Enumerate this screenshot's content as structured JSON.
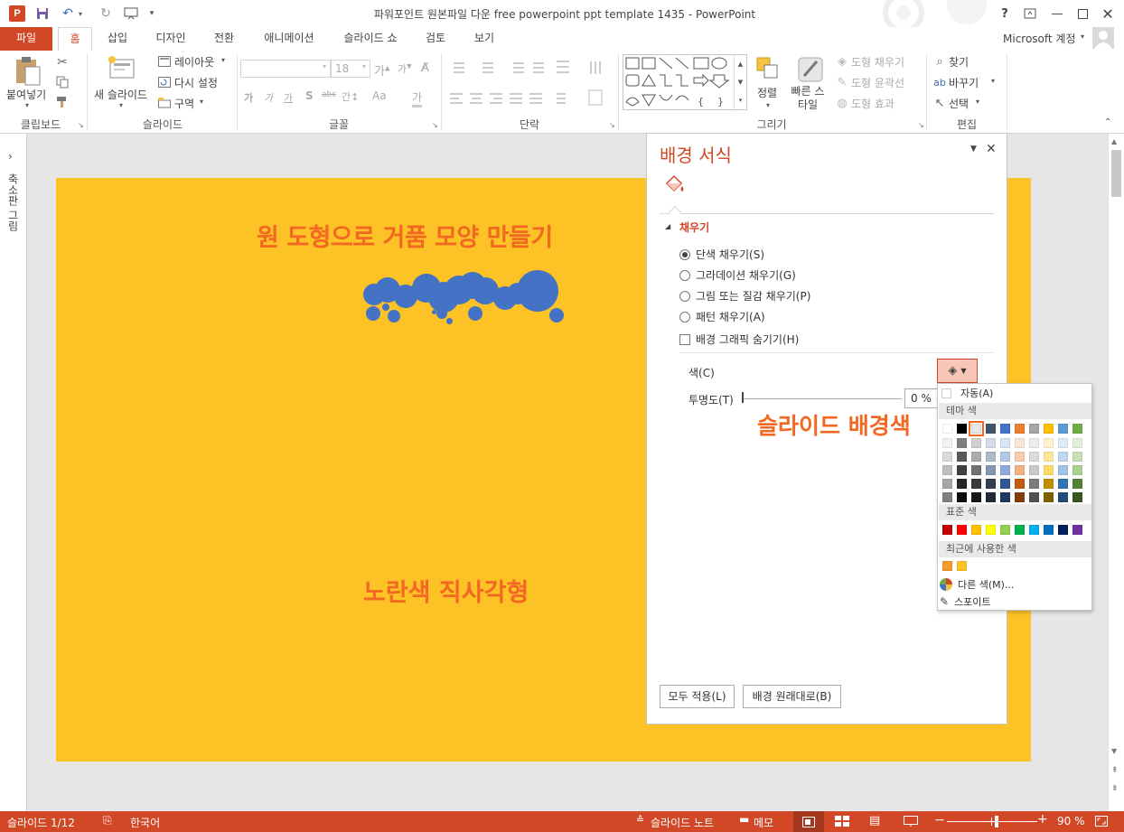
{
  "window": {
    "title": "파워포인트 원본파일 다운 free powerpoint ppt template 1435 - PowerPoint",
    "help": "?",
    "account": "Microsoft 계정"
  },
  "tabs": [
    "파일",
    "홈",
    "삽입",
    "디자인",
    "전환",
    "애니메이션",
    "슬라이드 쇼",
    "검토",
    "보기"
  ],
  "ribbon": {
    "clipboard": {
      "paste": "붙여넣기",
      "group": "클립보드"
    },
    "slides": {
      "new_slide": "새 슬라이드",
      "layout": "레이아웃",
      "reset": "다시 설정",
      "section": "구역",
      "group": "슬라이드"
    },
    "font": {
      "size": "18",
      "group": "글꼴",
      "bold": "가",
      "italic": "가",
      "underline": "가",
      "shadow": "S",
      "strike": "abc",
      "spacing": "간↕",
      "case": "Aa",
      "color": "가"
    },
    "paragraph": {
      "group": "단락"
    },
    "drawing": {
      "arrange": "정렬",
      "quick_styles": "빠른 스타일",
      "fill": "도형 채우기",
      "outline": "도형 윤곽선",
      "effects": "도형 효과",
      "group": "그리기"
    },
    "editing": {
      "find": "찾기",
      "replace": "바꾸기",
      "select": "선택",
      "group": "편집"
    }
  },
  "left_pane": {
    "label": "축소판 그림"
  },
  "slide": {
    "title": "원 도형으로 거품 모양 만들기",
    "bottom_label": "노란색 직사각형",
    "annotation": "슬라이드 배경색",
    "background_color": "#fdc226"
  },
  "format_pane": {
    "title": "배경 서식",
    "section": "채우기",
    "options": [
      "단색 채우기(S)",
      "그라데이션 채우기(G)",
      "그림 또는 질감 채우기(P)",
      "패턴 채우기(A)"
    ],
    "selected_option": 0,
    "hide_graphics": "배경 그래픽 숨기기(H)",
    "color_label": "색(C)",
    "transparency_label": "투명도(T)",
    "transparency_value": "0 %",
    "apply_all": "모두 적용(L)",
    "reset_bg": "배경 원래대로(B)"
  },
  "color_menu": {
    "auto": "자동(A)",
    "theme_header": "테마 색",
    "standard_header": "표준 색",
    "recent_header": "최근에 사용한 색",
    "more_colors": "다른 색(M)...",
    "eyedropper": "스포이트",
    "theme_colors": [
      [
        "#ffffff",
        "#f2f2f2",
        "#d9d9d9",
        "#bfbfbf",
        "#a6a6a6",
        "#808080"
      ],
      [
        "#000000",
        "#7f7f7f",
        "#595959",
        "#404040",
        "#262626",
        "#0d0d0d"
      ],
      [
        "#e7e6e6",
        "#d0cece",
        "#aeabab",
        "#757171",
        "#3a3838",
        "#171616"
      ],
      [
        "#44546a",
        "#d6dce5",
        "#adb9ca",
        "#8497b0",
        "#333f50",
        "#222a35"
      ],
      [
        "#4472c4",
        "#dae3f3",
        "#b4c7e7",
        "#8faadc",
        "#2f5597",
        "#1f3864"
      ],
      [
        "#ed7d31",
        "#fbe5d6",
        "#f8cbad",
        "#f4b183",
        "#c55a11",
        "#843c0c"
      ],
      [
        "#a5a5a5",
        "#ededed",
        "#dbdbdb",
        "#c9c9c9",
        "#7b7b7b",
        "#525252"
      ],
      [
        "#ffc000",
        "#fff2cc",
        "#ffe699",
        "#ffd966",
        "#bf9000",
        "#7f6000"
      ],
      [
        "#5b9bd5",
        "#deebf7",
        "#bdd7ee",
        "#9dc3e6",
        "#2e75b6",
        "#1f4e79"
      ],
      [
        "#70ad47",
        "#e2f0d9",
        "#c5e0b4",
        "#a9d18e",
        "#548235",
        "#385723"
      ]
    ],
    "standard_colors": [
      "#c00000",
      "#ff0000",
      "#ffc000",
      "#ffff00",
      "#92d050",
      "#00b050",
      "#00b0f0",
      "#0070c0",
      "#002060",
      "#7030a0"
    ],
    "recent_colors": [
      "#f79a2c",
      "#fdc226"
    ]
  },
  "status": {
    "slide_info": "슬라이드 1/12",
    "language": "한국어",
    "notes": "슬라이드 노트",
    "comments": "메모",
    "zoom": "90 %",
    "zoom_fraction": 0.55
  },
  "accent": "#d24726"
}
